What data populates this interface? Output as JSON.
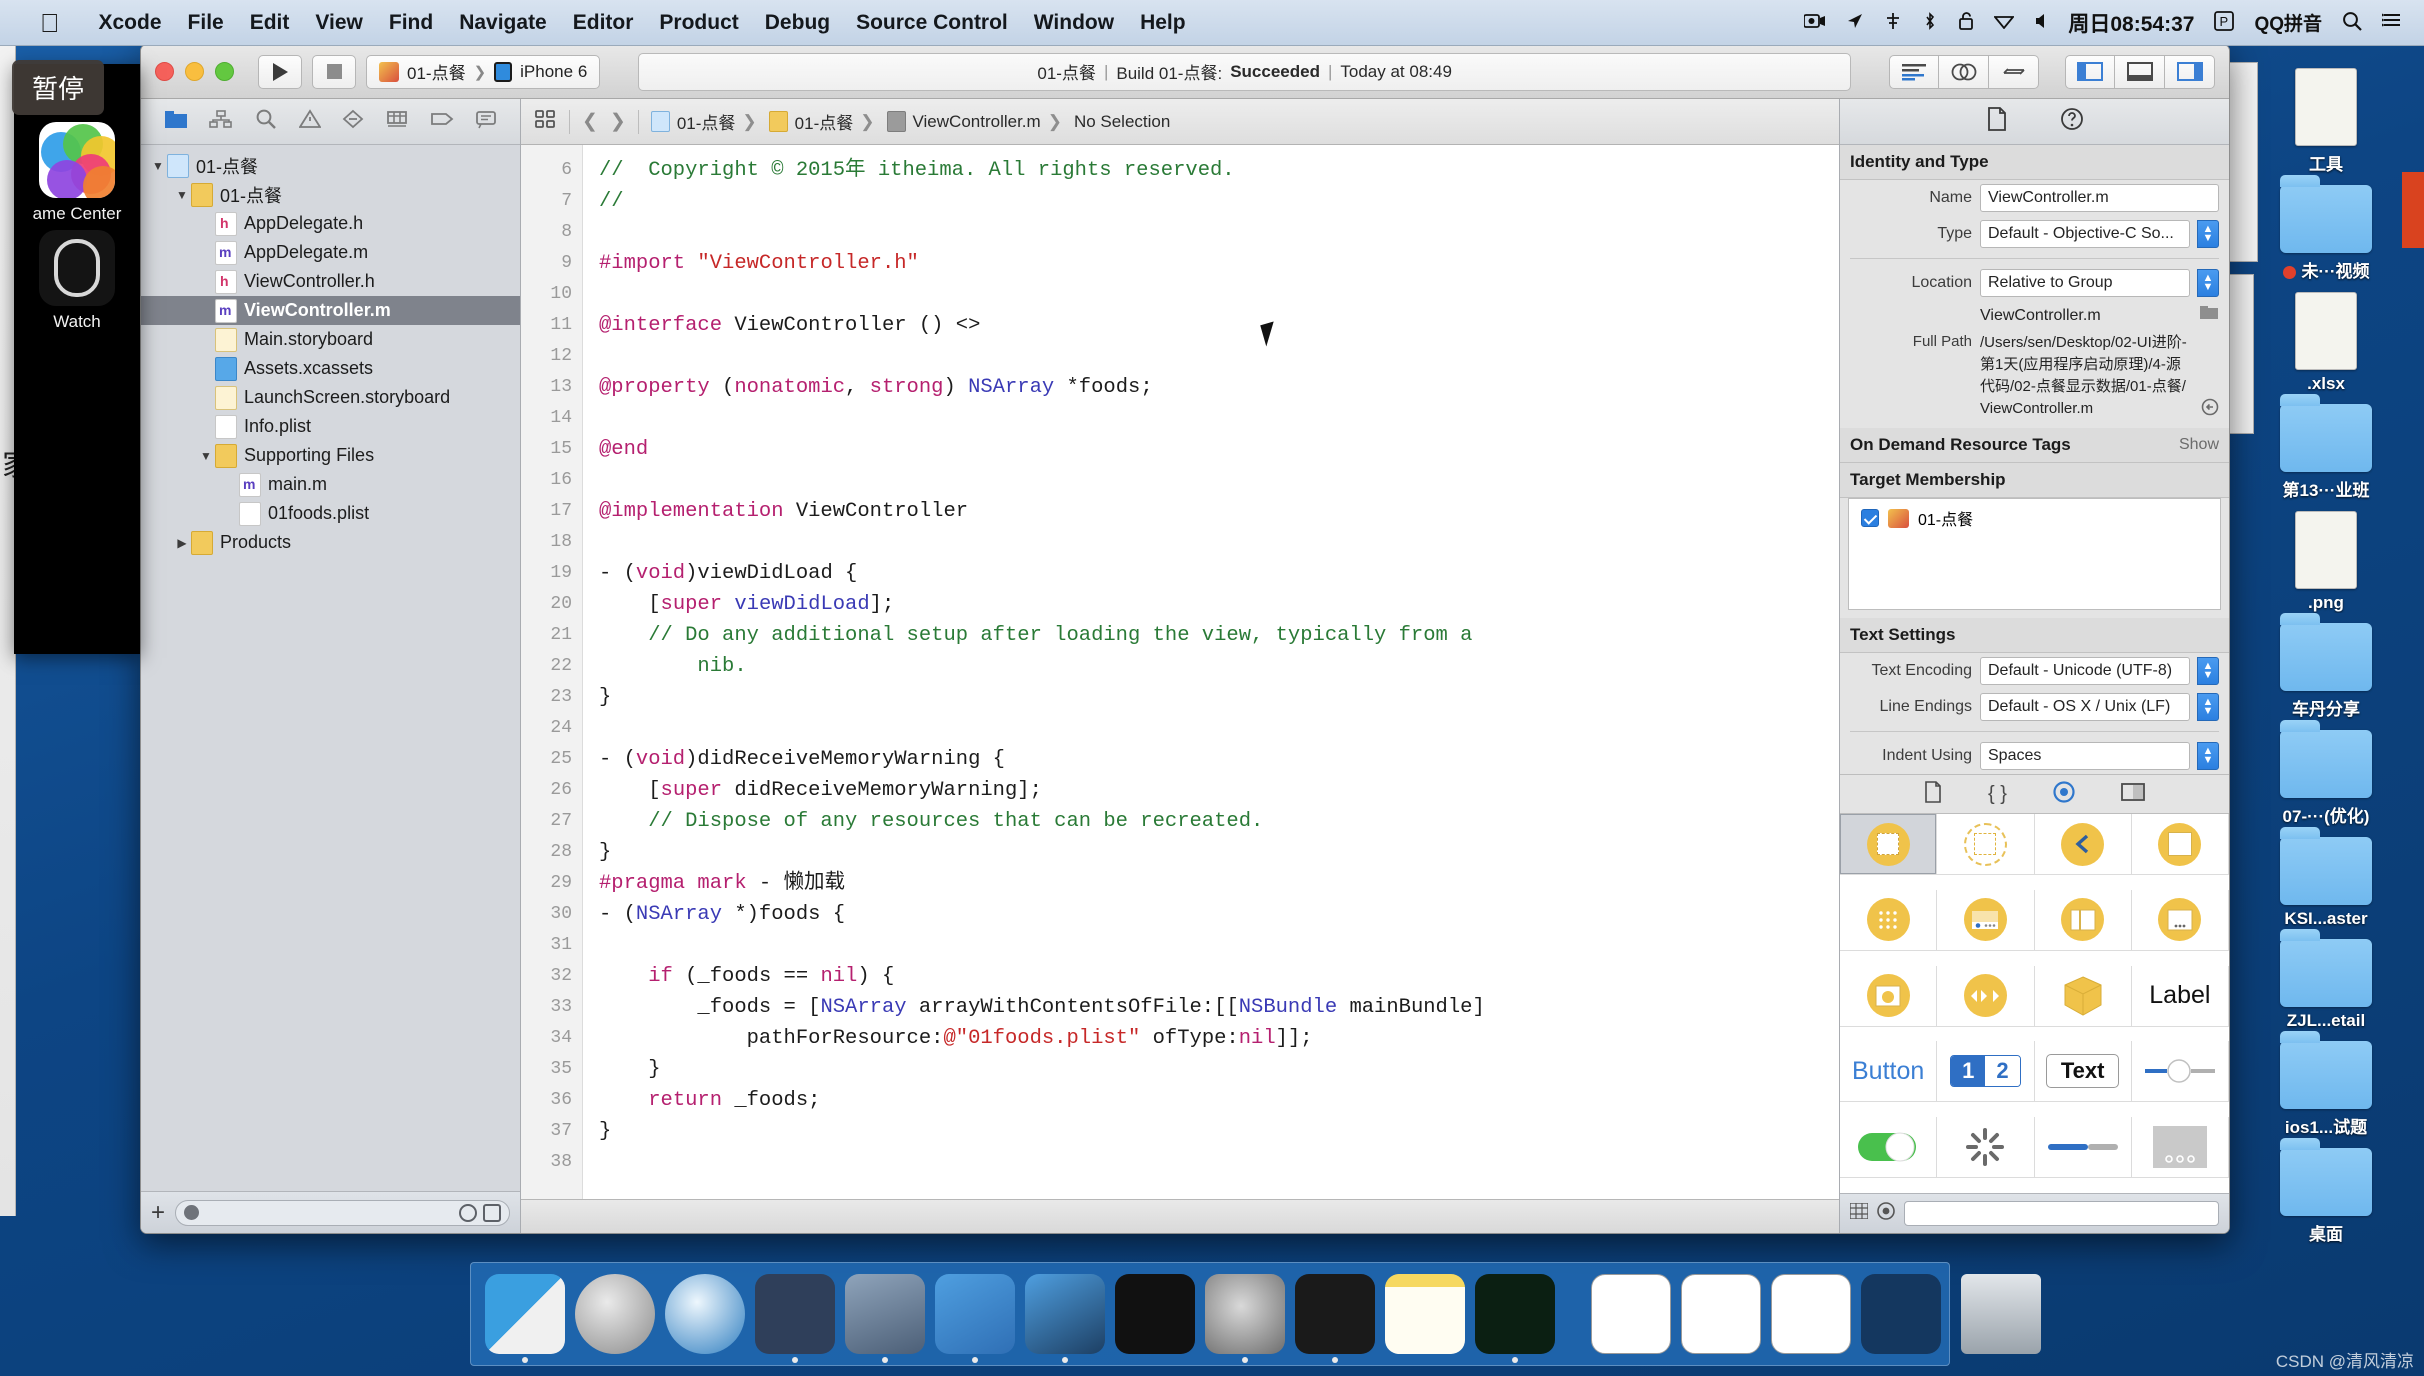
{
  "menubar": {
    "apple_icon": "apple-logo-icon",
    "items": [
      "Xcode",
      "File",
      "Edit",
      "View",
      "Find",
      "Navigate",
      "Editor",
      "Product",
      "Debug",
      "Source Control",
      "Window",
      "Help"
    ],
    "status_icons": [
      "screen-record-icon",
      "location-icon",
      "airplay-icon",
      "bluetooth-icon",
      "lock-icon",
      "dropbox-icon",
      "volume-icon"
    ],
    "clock": "周日08:54:37",
    "parallels": "P",
    "input_method": "QQ拼音",
    "search_icon": "search-icon",
    "notification_icon": "notification-center-icon"
  },
  "toolbar": {
    "run_icon": "play-icon",
    "stop_icon": "stop-icon",
    "scheme_project": "01-点餐",
    "scheme_device": "iPhone 6",
    "status": {
      "project": "01-点餐",
      "action": "Build 01-点餐:",
      "result": "Succeeded",
      "time": "Today at 08:49",
      "separator": "|"
    },
    "editor_buttons": [
      "standard-editor-icon",
      "assistant-editor-icon",
      "version-editor-icon"
    ],
    "view_buttons": [
      "toggle-navigator-icon",
      "toggle-debug-area-icon",
      "toggle-utilities-icon"
    ]
  },
  "navigator": {
    "tabs": [
      "project-navigator-icon",
      "symbol-navigator-icon",
      "find-navigator-icon",
      "issue-navigator-icon",
      "test-navigator-icon",
      "debug-navigator-icon",
      "breakpoint-navigator-icon",
      "report-navigator-icon"
    ],
    "tree": [
      {
        "label": "01-点餐",
        "indent": 0,
        "icon": "project-icon",
        "twisty": "▼",
        "selected": false
      },
      {
        "label": "01-点餐",
        "indent": 1,
        "icon": "folder-icon",
        "twisty": "▼",
        "selected": false
      },
      {
        "label": "AppDelegate.h",
        "indent": 2,
        "icon": "header-file-icon",
        "twisty": "",
        "selected": false
      },
      {
        "label": "AppDelegate.m",
        "indent": 2,
        "icon": "source-file-icon",
        "twisty": "",
        "selected": false
      },
      {
        "label": "ViewController.h",
        "indent": 2,
        "icon": "header-file-icon",
        "twisty": "",
        "selected": false
      },
      {
        "label": "ViewController.m",
        "indent": 2,
        "icon": "source-file-icon",
        "twisty": "",
        "selected": true
      },
      {
        "label": "Main.storyboard",
        "indent": 2,
        "icon": "storyboard-icon",
        "twisty": "",
        "selected": false
      },
      {
        "label": "Assets.xcassets",
        "indent": 2,
        "icon": "xcassets-icon",
        "twisty": "",
        "selected": false
      },
      {
        "label": "LaunchScreen.storyboard",
        "indent": 2,
        "icon": "storyboard-icon",
        "twisty": "",
        "selected": false
      },
      {
        "label": "Info.plist",
        "indent": 2,
        "icon": "plist-icon",
        "twisty": "",
        "selected": false
      },
      {
        "label": "Supporting Files",
        "indent": 2,
        "icon": "folder-icon",
        "twisty": "▼",
        "selected": false
      },
      {
        "label": "main.m",
        "indent": 3,
        "icon": "source-file-icon",
        "twisty": "",
        "selected": false
      },
      {
        "label": "01foods.plist",
        "indent": 3,
        "icon": "plist-icon",
        "twisty": "",
        "selected": false
      },
      {
        "label": "Products",
        "indent": 1,
        "icon": "folder-icon",
        "twisty": "▶",
        "selected": false
      }
    ],
    "footer": {
      "add_label": "+",
      "filter_placeholder": ""
    }
  },
  "jumpbar": {
    "related_icon": "related-items-icon",
    "back_icon": "back-arrow-icon",
    "forward_icon": "forward-arrow-icon",
    "crumbs": [
      "01-点餐",
      "01-点餐",
      "ViewController.m",
      "No Selection"
    ]
  },
  "editor": {
    "first_line_number": 6,
    "lines": [
      {
        "n": 6,
        "tokens": [
          [
            "cmt",
            "//  Copyright © 2015年 itheima. All rights reserved."
          ]
        ]
      },
      {
        "n": 7,
        "tokens": [
          [
            "cmt",
            "//"
          ]
        ]
      },
      {
        "n": 8,
        "tokens": [
          [
            "pln",
            ""
          ]
        ]
      },
      {
        "n": 9,
        "tokens": [
          [
            "pre",
            "#import "
          ],
          [
            "str",
            "\"ViewController.h\""
          ]
        ]
      },
      {
        "n": 10,
        "tokens": [
          [
            "pln",
            ""
          ]
        ]
      },
      {
        "n": 11,
        "tokens": [
          [
            "kw",
            "@interface"
          ],
          [
            "pln",
            " ViewController () <>"
          ]
        ]
      },
      {
        "n": 12,
        "tokens": [
          [
            "pln",
            ""
          ]
        ]
      },
      {
        "n": 13,
        "tokens": [
          [
            "kw",
            "@property"
          ],
          [
            "pln",
            " ("
          ],
          [
            "kw",
            "nonatomic"
          ],
          [
            "pln",
            ", "
          ],
          [
            "kw",
            "strong"
          ],
          [
            "pln",
            ") "
          ],
          [
            "typ",
            "NSArray"
          ],
          [
            "pln",
            " *foods;"
          ]
        ]
      },
      {
        "n": 14,
        "tokens": [
          [
            "pln",
            ""
          ]
        ]
      },
      {
        "n": 15,
        "tokens": [
          [
            "kw",
            "@end"
          ]
        ]
      },
      {
        "n": 16,
        "tokens": [
          [
            "pln",
            ""
          ]
        ]
      },
      {
        "n": 17,
        "tokens": [
          [
            "kw",
            "@implementation"
          ],
          [
            "pln",
            " ViewController"
          ]
        ]
      },
      {
        "n": 18,
        "tokens": [
          [
            "pln",
            ""
          ]
        ]
      },
      {
        "n": 19,
        "tokens": [
          [
            "pln",
            "- ("
          ],
          [
            "kw",
            "void"
          ],
          [
            "pln",
            ")viewDidLoad {"
          ]
        ]
      },
      {
        "n": 20,
        "tokens": [
          [
            "pln",
            "    ["
          ],
          [
            "kw",
            "super"
          ],
          [
            "pln",
            " "
          ],
          [
            "typ",
            "viewDidLoad"
          ],
          [
            "pln",
            "];"
          ]
        ]
      },
      {
        "n": 21,
        "tokens": [
          [
            "cmt",
            "    // Do any additional setup after loading the view, typically from a"
          ]
        ]
      },
      {
        "n": null,
        "tokens": [
          [
            "cmt",
            "        nib."
          ]
        ]
      },
      {
        "n": 22,
        "tokens": [
          [
            "pln",
            "}"
          ]
        ]
      },
      {
        "n": 23,
        "tokens": [
          [
            "pln",
            ""
          ]
        ]
      },
      {
        "n": 24,
        "tokens": [
          [
            "pln",
            "- ("
          ],
          [
            "kw",
            "void"
          ],
          [
            "pln",
            ")didReceiveMemoryWarning {"
          ]
        ]
      },
      {
        "n": 25,
        "tokens": [
          [
            "pln",
            "    ["
          ],
          [
            "kw",
            "super"
          ],
          [
            "pln",
            " didReceiveMemoryWarning];"
          ]
        ]
      },
      {
        "n": 26,
        "tokens": [
          [
            "cmt",
            "    // Dispose of any resources that can be recreated."
          ]
        ]
      },
      {
        "n": 27,
        "tokens": [
          [
            "pln",
            "}"
          ]
        ]
      },
      {
        "n": 28,
        "tokens": [
          [
            "pre",
            "#pragma mark"
          ],
          [
            "pln",
            " - 懒加载"
          ]
        ]
      },
      {
        "n": 29,
        "tokens": [
          [
            "pln",
            "- ("
          ],
          [
            "typ",
            "NSArray"
          ],
          [
            "pln",
            " *)foods {"
          ]
        ]
      },
      {
        "n": 30,
        "tokens": [
          [
            "pln",
            ""
          ]
        ]
      },
      {
        "n": 31,
        "tokens": [
          [
            "pln",
            "    "
          ],
          [
            "kw",
            "if"
          ],
          [
            "pln",
            " (_foods == "
          ],
          [
            "kw",
            "nil"
          ],
          [
            "pln",
            ") {"
          ]
        ]
      },
      {
        "n": 32,
        "tokens": [
          [
            "pln",
            "        _foods = ["
          ],
          [
            "typ",
            "NSArray"
          ],
          [
            "pln",
            " arrayWithContentsOfFile:[["
          ],
          [
            "typ",
            "NSBundle"
          ],
          [
            "pln",
            " mainBundle]"
          ]
        ]
      },
      {
        "n": null,
        "tokens": [
          [
            "pln",
            "            pathForResource:"
          ],
          [
            "str",
            "@\"01foods.plist\""
          ],
          [
            "pln",
            " ofType:"
          ],
          [
            "kw",
            "nil"
          ],
          [
            "pln",
            "]];"
          ]
        ]
      },
      {
        "n": 33,
        "tokens": [
          [
            "pln",
            "    }"
          ]
        ]
      },
      {
        "n": 34,
        "tokens": [
          [
            "pln",
            "    "
          ],
          [
            "kw",
            "return"
          ],
          [
            "pln",
            " _foods;"
          ]
        ]
      },
      {
        "n": 35,
        "tokens": [
          [
            "pln",
            "}"
          ]
        ]
      },
      {
        "n": 36,
        "tokens": [
          [
            "pln",
            ""
          ]
        ]
      },
      {
        "n": 37,
        "tokens": [
          [
            "pln",
            ""
          ]
        ]
      },
      {
        "n": 38,
        "tokens": [
          [
            "pln",
            ""
          ]
        ]
      }
    ]
  },
  "inspector": {
    "tabs": [
      "file-inspector-icon",
      "quick-help-icon"
    ],
    "identity": {
      "title": "Identity and Type",
      "name_label": "Name",
      "name_value": "ViewController.m",
      "type_label": "Type",
      "type_value": "Default - Objective-C So...",
      "location_label": "Location",
      "location_value": "Relative to Group",
      "location_file": "ViewController.m",
      "full_path_label": "Full Path",
      "full_path_value": "/Users/sen/Desktop/02-UI进阶-第1天(应用程序启动原理)/4-源代码/02-点餐显示数据/01-点餐/ViewController.m"
    },
    "on_demand": {
      "title": "On Demand Resource Tags",
      "show": "Show"
    },
    "target_membership": {
      "title": "Target Membership",
      "items": [
        {
          "label": "01-点餐",
          "checked": true
        }
      ]
    },
    "text_settings": {
      "title": "Text Settings",
      "encoding_label": "Text Encoding",
      "encoding_value": "Default - Unicode (UTF-8)",
      "line_endings_label": "Line Endings",
      "line_endings_value": "Default - OS X / Unix (LF)",
      "indent_label": "Indent Using",
      "indent_value": "Spaces"
    },
    "library": {
      "tabs": [
        "file-template-library-icon",
        "code-snippet-library-icon",
        "object-library-icon",
        "media-library-icon"
      ],
      "selected_tab": 2,
      "objects": [
        {
          "name": "view-controller-object",
          "kind": "circle-square",
          "selected": true,
          "label": ""
        },
        {
          "name": "storyboard-reference-object",
          "kind": "circle-dashed",
          "selected": false,
          "label": ""
        },
        {
          "name": "navigation-controller-object",
          "kind": "circle-chevron",
          "selected": false,
          "label": ""
        },
        {
          "name": "table-view-controller-object",
          "kind": "circle-lines",
          "selected": false,
          "label": ""
        },
        {
          "name": "collection-view-controller-object",
          "kind": "circle-grid",
          "selected": false,
          "label": ""
        },
        {
          "name": "tab-bar-controller-object",
          "kind": "circle-tabbar",
          "selected": false,
          "label": ""
        },
        {
          "name": "split-view-controller-object",
          "kind": "circle-split",
          "selected": false,
          "label": ""
        },
        {
          "name": "page-view-controller-object",
          "kind": "circle-page",
          "selected": false,
          "label": ""
        },
        {
          "name": "image-picker-controller-object",
          "kind": "circle-picker",
          "selected": false,
          "label": ""
        },
        {
          "name": "av-player-controller-object",
          "kind": "circle-player",
          "selected": false,
          "label": ""
        },
        {
          "name": "gl-kit-view-controller-object",
          "kind": "cube",
          "selected": false,
          "label": ""
        },
        {
          "name": "label-object",
          "kind": "text",
          "selected": false,
          "label": "Label"
        },
        {
          "name": "button-object",
          "kind": "text-blue",
          "selected": false,
          "label": "Button"
        },
        {
          "name": "segmented-control-object",
          "kind": "segmented",
          "selected": false,
          "label": "1 2"
        },
        {
          "name": "text-field-object",
          "kind": "textfield",
          "selected": false,
          "label": "Text"
        },
        {
          "name": "slider-object",
          "kind": "slider",
          "selected": false,
          "label": ""
        },
        {
          "name": "switch-object",
          "kind": "switch",
          "selected": false,
          "label": ""
        },
        {
          "name": "activity-indicator-object",
          "kind": "spinner",
          "selected": false,
          "label": ""
        },
        {
          "name": "progress-view-object",
          "kind": "progress",
          "selected": false,
          "label": ""
        },
        {
          "name": "page-control-object",
          "kind": "pagecontrol",
          "selected": false,
          "label": ""
        }
      ],
      "footer_search_placeholder": ""
    }
  },
  "left_panel": {
    "tooltip": "暂停",
    "apps": [
      {
        "label": "ame Center",
        "icon": "game-center-icon"
      },
      {
        "label": "Watch",
        "icon": "watch-app-icon"
      }
    ]
  },
  "desktop": {
    "folders": [
      {
        "label": "工具",
        "icon": "folder-icon",
        "partial": true
      },
      {
        "label": "未···视频",
        "icon": "folder-icon",
        "badge": "red-dot"
      },
      {
        "label": ".xlsx",
        "icon": "excel-file-icon",
        "partial": true
      },
      {
        "label": "第13···业班",
        "icon": "folder-icon"
      },
      {
        "label": ".png",
        "icon": "image-file-icon",
        "partial": true
      },
      {
        "label": "车丹分享",
        "icon": "folder-icon"
      },
      {
        "label": "07-···(优化)",
        "icon": "folder-icon"
      },
      {
        "label": "KSI...aster",
        "icon": "folder-icon"
      },
      {
        "label": "ZJL...etail",
        "icon": "folder-icon"
      },
      {
        "label": "ios1...试题",
        "icon": "folder-icon"
      },
      {
        "label": "桌面",
        "icon": "folder-icon"
      }
    ]
  },
  "dock": {
    "items": [
      {
        "name": "finder-dock-icon",
        "class": "di-finder",
        "running": true
      },
      {
        "name": "launchpad-dock-icon",
        "class": "di-launchpad",
        "running": false
      },
      {
        "name": "safari-dock-icon",
        "class": "di-safari",
        "running": false
      },
      {
        "name": "mail-dock-icon",
        "class": "di-mail",
        "running": true
      },
      {
        "name": "quicktime-dock-icon",
        "class": "di-qt",
        "running": true
      },
      {
        "name": "xcode-dock-icon",
        "class": "di-xcode",
        "running": true
      },
      {
        "name": "xcode-beta-dock-icon",
        "class": "di-xcode2",
        "running": true
      },
      {
        "name": "terminal-dock-icon",
        "class": "di-term",
        "running": false
      },
      {
        "name": "system-preferences-dock-icon",
        "class": "di-prefs",
        "running": true
      },
      {
        "name": "photoshop-dock-icon",
        "class": "di-ps",
        "running": true
      },
      {
        "name": "notes-dock-icon",
        "class": "di-notes",
        "running": false
      },
      {
        "name": "dashcode-dock-icon",
        "class": "di-dash",
        "running": true
      }
    ],
    "minimized": [
      {
        "name": "minimized-window-1",
        "class": "di-doc1"
      },
      {
        "name": "minimized-window-2",
        "class": "di-doc2"
      },
      {
        "name": "minimized-window-3",
        "class": "di-doc3"
      },
      {
        "name": "minimized-window-4",
        "class": "di-doc4"
      }
    ],
    "trash": {
      "name": "trash-dock-icon",
      "class": "di-trash"
    }
  },
  "watermark": "CSDN @清风清凉"
}
